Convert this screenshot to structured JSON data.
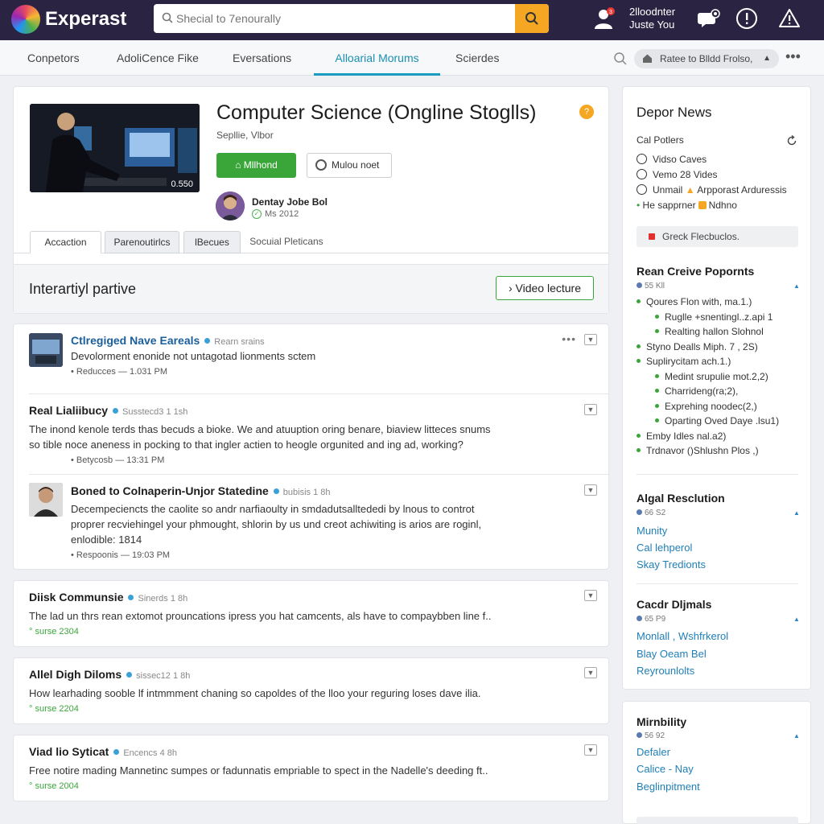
{
  "header": {
    "brand": "Experast",
    "search_placeholder": "Shecial to 7enourally",
    "user_line1": "2lloodnter",
    "user_line2": "Juste You",
    "notification_count": "3"
  },
  "nav": {
    "tabs": [
      "Conpetors",
      "AdoliCence Fike",
      "Eversations",
      "Alloarial Morums",
      "Scierdes"
    ],
    "active_tab": "Alloarial Morums",
    "pill_label": "Ratee to Blldd Frolso,"
  },
  "course": {
    "title": "Computer Science (Ongline Stoglls)",
    "info_badge": "?",
    "subtitle": "Sepllie, Vlbor",
    "duration": "0.550",
    "primary_button": "Mllhond",
    "secondary_button": "Mulou noet",
    "instructor_name": "Dentay Jobe Bol",
    "instructor_meta": "Ms 2012",
    "subtabs": [
      "Accaction",
      "Parenoutirlcs",
      "lBecues",
      "Socuial Pleticans"
    ],
    "panel_title": "Interartiyl partive",
    "panel_button": "› Video lecture"
  },
  "threads": [
    {
      "title": "Ctlregiged Nave Eareals",
      "meta": "Rearn srains",
      "body": [
        "Devolorment enonide not untagotad lionments sctem"
      ],
      "footer": "Reducces  —  1.031 PM"
    },
    {
      "title": "Real Lialiibucy",
      "meta": "Susstecd3 1 1sh",
      "body": [
        "The inond kenole terds thas becuds a bioke. We and atuuption oring benare, biaview litteces snums",
        "so tible noce aneness in pocking to that ingler actien to heogle orgunited and ing ad, working?"
      ],
      "footer": "Betycosb  —  13:31 PM"
    },
    {
      "title": "Boned to Colnaperin-Unjor Statedine",
      "meta": "bubisis 1 8h",
      "body": [
        "Decempeciencts the caolite so andr narfiaoulty in smdadutsalltededi by lnous to controt",
        "proprer recviehingel your phmought, shlorin by us und creot achiwiting is arios are roginl,",
        "enlodible: 1814"
      ],
      "footer": "Respoonis  —  19:03 PM"
    }
  ],
  "mini_posts": [
    {
      "title": "Diisk Communsie",
      "meta": "Sinerds 1 8h",
      "body": "The lad un thrs rean extomot prouncations ipress you hat camcents, als have to compaybben line f..",
      "footer": "surse 2304"
    },
    {
      "title": "Allel Digh Diloms",
      "meta": "sissec12 1 8h",
      "body": "How learhading sooble lf intmmment chaning so capoldes of the lloo your reguring loses dave ilia.",
      "footer": "surse 2204"
    },
    {
      "title": "Viad lio Syticat",
      "meta": "Encencs 4 8h",
      "body": "Free notire mading Mannetinc sumpes or fadunnatis empriable to spect in the Nadelle's deeding ft..",
      "footer": "surse 2004"
    }
  ],
  "sidebar": {
    "news_title": "Depor News",
    "news_subtitle": "Cal Potlers",
    "options": [
      "Vidso Caves",
      "Vemo 28 Vides",
      "Unmail",
      "Arpporast Arduressis"
    ],
    "happener_label": "He sapprner",
    "happener_value": "Ndhno",
    "grey_box": "Greck Flecbuclos.",
    "popular_title": "Rean Creive Popornts",
    "tree": [
      {
        "level": 1,
        "text": "Qoures Flon with, ma.1.)"
      },
      {
        "level": 2,
        "text": "Ruglle +snentingl..z.api 1"
      },
      {
        "level": 2,
        "text": "Realting hallon Slohnol"
      },
      {
        "level": 1,
        "text": "Styno Dealls Miph. 7 , 2S)"
      },
      {
        "level": 1,
        "text": "Suplirycitam ach.1.)"
      },
      {
        "level": 2,
        "text": "Medint srupulie mot.2,2)"
      },
      {
        "level": 2,
        "text": "Charrideng(ra;2),"
      },
      {
        "level": 2,
        "text": "Exprehing noodec(2,)"
      },
      {
        "level": 2,
        "text": "Oparting Oved Daye .lsu1)"
      },
      {
        "level": 1,
        "text": "Emby Idles nal.a2)"
      },
      {
        "level": 1,
        "text": "Trdnavor ()Shlushn Plos ,)"
      }
    ],
    "sections": [
      {
        "title": "Algal Resclution",
        "meta": "66 S2",
        "links": [
          "Munity",
          "Cal lehperol",
          "Skay Tredionts"
        ]
      },
      {
        "title": "Cacdr Dljmals",
        "meta": "65 P9",
        "links": [
          "Monlall , Wshfrkerol",
          "Blay Oeam Bel",
          "Reyrounlolts"
        ]
      }
    ],
    "lower_section": {
      "title": "Mirnbility",
      "meta": "56 92",
      "links": [
        "Defaler",
        "Calice - Nay",
        "Beglinpitment"
      ]
    }
  },
  "colors": {
    "topbar": "#2a2442",
    "accent": "#1a9cc0",
    "green": "#3aa63a",
    "orange": "#f5a623"
  }
}
